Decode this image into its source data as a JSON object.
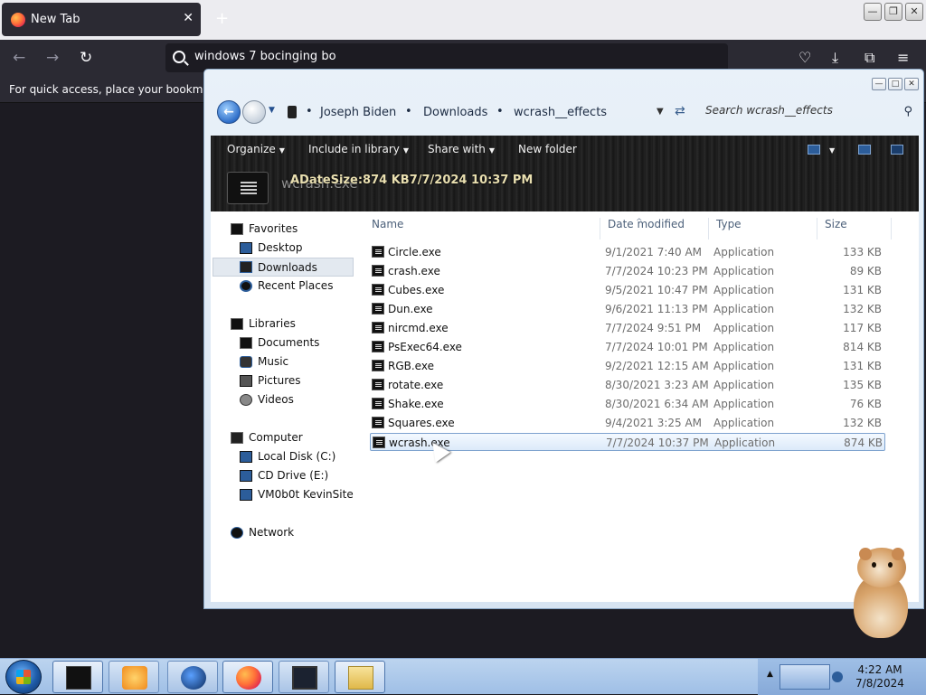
{
  "browser": {
    "tab_title": "New Tab",
    "tab_close": "✕",
    "new_tab": "+",
    "url_value": "windows 7 bocinging bo",
    "bookmarks_hint": "For quick access, place your bookmarks here on the bookmarks toolbar.",
    "nav": {
      "back": "←",
      "forward": "→",
      "reload": "↻"
    },
    "toolbar": {
      "pocket": "♡",
      "download": "⤓",
      "extensions": "⧉",
      "menu": "≡"
    },
    "window_controls": {
      "minimize": "—",
      "restore": "❐",
      "close": "✕"
    }
  },
  "explorer": {
    "window_controls": {
      "minimize": "—",
      "maximize": "□",
      "close": "✕"
    },
    "breadcrumbs": [
      "Joseph Biden",
      "Downloads",
      "wcrash__effects"
    ],
    "crumb_sep": "•",
    "search_placeholder": "Search wcrash__effects",
    "commands": {
      "organize": "Organize",
      "include_in_library": "Include in library",
      "share_with": "Share with",
      "new_folder": "New folder",
      "dropdown_arrow": "▼"
    },
    "details": {
      "file_name": "wcrash.exe",
      "meta": "ADateSize:874 KB7/7/2024 10:37 PM"
    },
    "nav": {
      "favorites": "Favorites",
      "desktop": "Desktop",
      "downloads": "Downloads",
      "recent_places": "Recent Places",
      "libraries": "Libraries",
      "documents": "Documents",
      "music": "Music",
      "pictures": "Pictures",
      "videos": "Videos",
      "computer": "Computer",
      "local_disk": "Local Disk (C:)",
      "cd_drive": "CD Drive (E:)",
      "vm_share": "VM0b0t KevinSite",
      "network": "Network"
    },
    "columns": {
      "name": "Name",
      "date_modified": "Date modified",
      "type": "Type",
      "size": "Size"
    },
    "files": [
      {
        "name": "Circle.exe",
        "date": "9/1/2021 7:40 AM",
        "type": "Application",
        "size": "133 KB"
      },
      {
        "name": "crash.exe",
        "date": "7/7/2024 10:23 PM",
        "type": "Application",
        "size": "89 KB"
      },
      {
        "name": "Cubes.exe",
        "date": "9/5/2021 10:47 PM",
        "type": "Application",
        "size": "131 KB"
      },
      {
        "name": "Dun.exe",
        "date": "9/6/2021 11:13 PM",
        "type": "Application",
        "size": "132 KB"
      },
      {
        "name": "nircmd.exe",
        "date": "7/7/2024 9:51 PM",
        "type": "Application",
        "size": "117 KB"
      },
      {
        "name": "PsExec64.exe",
        "date": "7/7/2024 10:01 PM",
        "type": "Application",
        "size": "814 KB"
      },
      {
        "name": "RGB.exe",
        "date": "9/2/2021 12:15 AM",
        "type": "Application",
        "size": "131 KB"
      },
      {
        "name": "rotate.exe",
        "date": "8/30/2021 3:23 AM",
        "type": "Application",
        "size": "135 KB"
      },
      {
        "name": "Shake.exe",
        "date": "8/30/2021 6:34 AM",
        "type": "Application",
        "size": "76 KB"
      },
      {
        "name": "Squares.exe",
        "date": "9/4/2021 3:25 AM",
        "type": "Application",
        "size": "132 KB"
      },
      {
        "name": "wcrash.exe",
        "date": "7/7/2024 10:37 PM",
        "type": "Application",
        "size": "874 KB"
      }
    ]
  },
  "taskbar": {
    "time": "4:22 AM",
    "date": "7/8/2024",
    "tray_expand": "▲"
  },
  "colors": {
    "browser_bg": "#1c1b22",
    "explorer_accent": "#2f6fc9",
    "taskbar": "#9fbfe6"
  }
}
